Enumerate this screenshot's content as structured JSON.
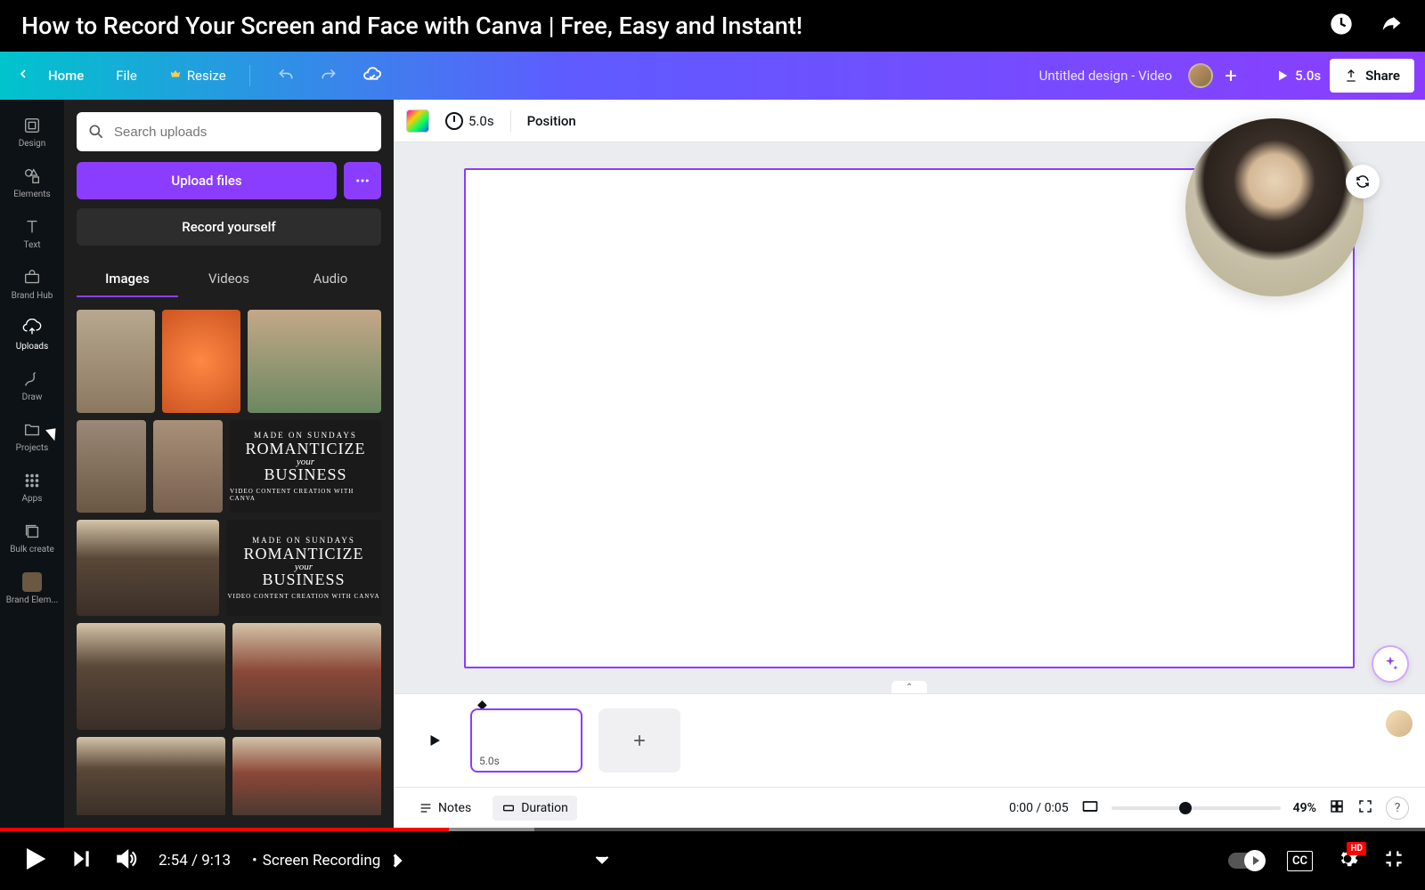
{
  "youtube": {
    "title": "How to Record Your Screen and Face with Canva | Free, Easy and Instant!",
    "current_time": "2:54",
    "total_time": "9:13",
    "chapter": "Screen Recording",
    "hd_badge": "HD",
    "cc_label": "CC"
  },
  "topbar": {
    "home": "Home",
    "file": "File",
    "resize": "Resize",
    "doc_title": "Untitled design - Video",
    "duration": "5.0s",
    "share": "Share"
  },
  "nav": {
    "design": "Design",
    "elements": "Elements",
    "text": "Text",
    "brand_hub": "Brand Hub",
    "uploads": "Uploads",
    "draw": "Draw",
    "projects": "Projects",
    "apps": "Apps",
    "bulk_create": "Bulk create",
    "brand_elem": "Brand Elem..."
  },
  "panel": {
    "search_placeholder": "Search uploads",
    "upload": "Upload files",
    "record": "Record yourself",
    "tabs": {
      "images": "Images",
      "videos": "Videos",
      "audio": "Audio"
    },
    "romanticize": {
      "tag": "MADE ON SUNDAYS",
      "l1": "ROMANTICIZE",
      "l2": "your",
      "l3": "BUSINESS",
      "sub": "VIDEO CONTENT CREATION WITH CANVA"
    }
  },
  "context": {
    "timer": "5.0s",
    "position": "Position"
  },
  "timeline": {
    "scene_dur": "5.0s",
    "notes": "Notes",
    "duration": "Duration",
    "time": "0:00 / 0:05",
    "zoom": "49%"
  }
}
